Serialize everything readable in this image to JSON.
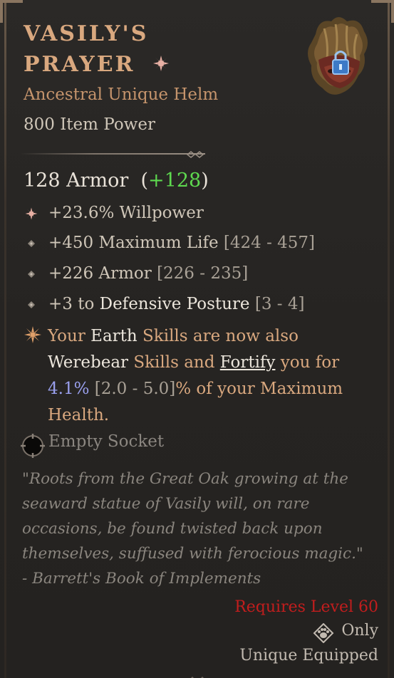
{
  "item": {
    "name_line1": "Vasily's",
    "name_line2": "Prayer",
    "type": "Ancestral Unique Helm",
    "item_power": "800 Item Power",
    "icon": "helm-icon",
    "lock_icon": "lock-icon"
  },
  "armor": {
    "value": "128 Armor",
    "bonus_open": "(",
    "bonus": "+128",
    "bonus_close": ")"
  },
  "affixes": [
    {
      "icon": "rune-icon",
      "text": "+23.6% Willpower",
      "range": ""
    },
    {
      "icon": "diamond-bullet-icon",
      "text": "+450 Maximum Life",
      "range": "[424 - 457]"
    },
    {
      "icon": "diamond-bullet-icon",
      "text": "+226 Armor",
      "range": "[226 - 235]"
    },
    {
      "icon": "diamond-bullet-icon",
      "text_pre": "+3 to",
      "text_skill": "Defensive Posture",
      "range": "[3 - 4]"
    }
  ],
  "unique_power": {
    "icon": "star-burst-icon",
    "p1": "Your",
    "p2": "Earth",
    "p3": "Skills are now also",
    "p4": "Werebear",
    "p5": "Skills and",
    "p6": "Fortify",
    "p7": "you for",
    "p8": "4.1%",
    "p9": "[2.0 - 5.0]",
    "p10": "% of your Maximum Health."
  },
  "socket": {
    "icon": "empty-socket-icon",
    "label": "Empty Socket"
  },
  "flavor": {
    "line1": "\"Roots from the Great Oak growing at the",
    "line2": "seaward statue of Vasily will, on rare",
    "line3": "occasions, be found twisted back upon",
    "line4": "themselves, suffused with ferocious magic.\"",
    "line5": "- Barrett's Book of Implements"
  },
  "requirements": {
    "level": "Requires Level 60",
    "class_icon": "druid-paw-icon",
    "only": "Only",
    "equipped": "Unique Equipped"
  },
  "colors": {
    "title": "#d9a87f",
    "bonus": "#5ed94f",
    "requirement": "#c21d1d",
    "value_blue": "#9aa0ee"
  }
}
